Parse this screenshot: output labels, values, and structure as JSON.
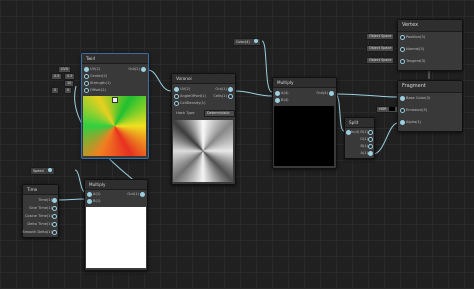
{
  "colors": {
    "background": "#202020",
    "node": "#393939",
    "wire": "#9ccfe0",
    "selected": "#3a6ea5"
  },
  "twirl": {
    "title": "Twirl",
    "inputs": [
      "UV(2)",
      "Center(2)",
      "Strength(1)",
      "Offset(2)"
    ],
    "output": "Out(2)",
    "uv_chip": "UV0",
    "center_x": "0.5",
    "center_y": "0.5",
    "strength": "10",
    "offset_x": "0",
    "offset_y": "0"
  },
  "voronoi": {
    "title": "Voronoi",
    "inputs": [
      "UV(2)",
      "AngleOffset(1)",
      "CellDensity(1)"
    ],
    "outputs": [
      "Out(1)",
      "Cells(1)"
    ],
    "hash_label": "Hash Type",
    "hash_value": "Deterministic"
  },
  "multiply_top": {
    "title": "Multiply",
    "inputs": [
      "A(4)",
      "B(4)"
    ],
    "output": "Out(4)"
  },
  "color_prop": {
    "label": "Color(4)"
  },
  "split": {
    "title": "Split",
    "input": "In(4)",
    "outputs": [
      "R(1)",
      "G(1)",
      "B(1)",
      "A(1)"
    ]
  },
  "vertex": {
    "title": "Vertex",
    "ports": [
      "Position(3)",
      "Normal(3)",
      "Tangent(3)"
    ],
    "chips": [
      "Object Space",
      "Object Space",
      "Object Space"
    ]
  },
  "fragment": {
    "title": "Fragment",
    "ports": [
      "Base Color(3)",
      "Emission(3)",
      "Alpha(1)"
    ],
    "emission_chip": "HDR"
  },
  "speed_prop": {
    "label": "Speed"
  },
  "time": {
    "title": "Time",
    "outputs": [
      "Time(1)",
      "Sine Time(1)",
      "Cosine Time(1)",
      "Delta Time(1)",
      "Smooth Delta(1)"
    ]
  },
  "multiply_bottom": {
    "title": "Multiply",
    "inputs": [
      "A(1)",
      "B(1)"
    ],
    "output": "Out(1)"
  }
}
